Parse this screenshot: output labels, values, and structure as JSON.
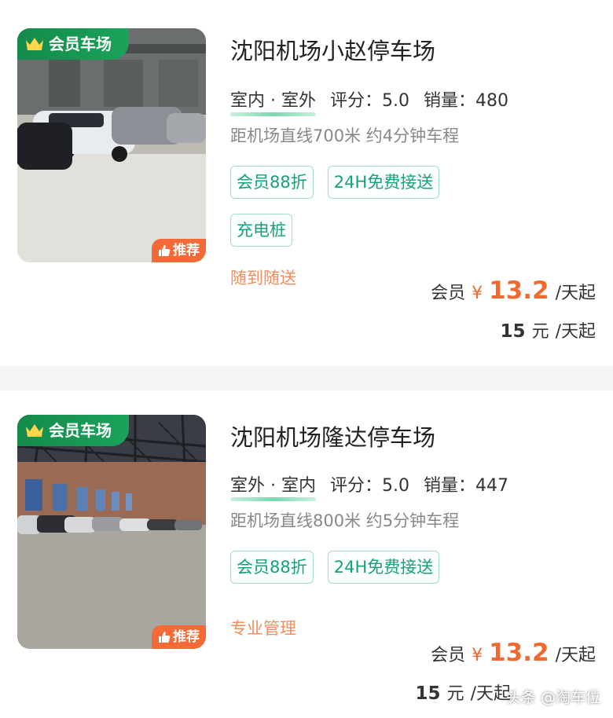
{
  "colors": {
    "accent_green": "#17a07a",
    "price_orange": "#f06a30",
    "recommend_orange": "#f46a37",
    "member_badge_green": "#138a4a"
  },
  "listings": [
    {
      "badge": "会员车场",
      "recommend": "推荐",
      "name": "沈阳机场小赵停车场",
      "location_type": "室内 · 室外",
      "rating_label": "评分：5.0",
      "sales_label": "销量：480",
      "distance": "距机场直线700米 约4分钟车程",
      "tags": [
        "会员88折",
        "24H免费接送",
        "充电桩"
      ],
      "note": "随到随送",
      "member_price_label": "会员",
      "currency": "¥",
      "member_price": "13.2",
      "per_day": "/天起",
      "regular_price": "15",
      "regular_unit": "元",
      "regular_per_day": "/天起"
    },
    {
      "badge": "会员车场",
      "recommend": "推荐",
      "name": "沈阳机场隆达停车场",
      "location_type": "室外 · 室内",
      "rating_label": "评分：5.0",
      "sales_label": "销量：447",
      "distance": "距机场直线800米 约5分钟车程",
      "tags": [
        "会员88折",
        "24H免费接送"
      ],
      "note": "专业管理",
      "member_price_label": "会员",
      "currency": "¥",
      "member_price": "13.2",
      "per_day": "/天起",
      "regular_price": "15",
      "regular_unit": "元",
      "regular_per_day": "/天起"
    }
  ],
  "watermark": {
    "source": "头条",
    "account": "@淘车位"
  }
}
